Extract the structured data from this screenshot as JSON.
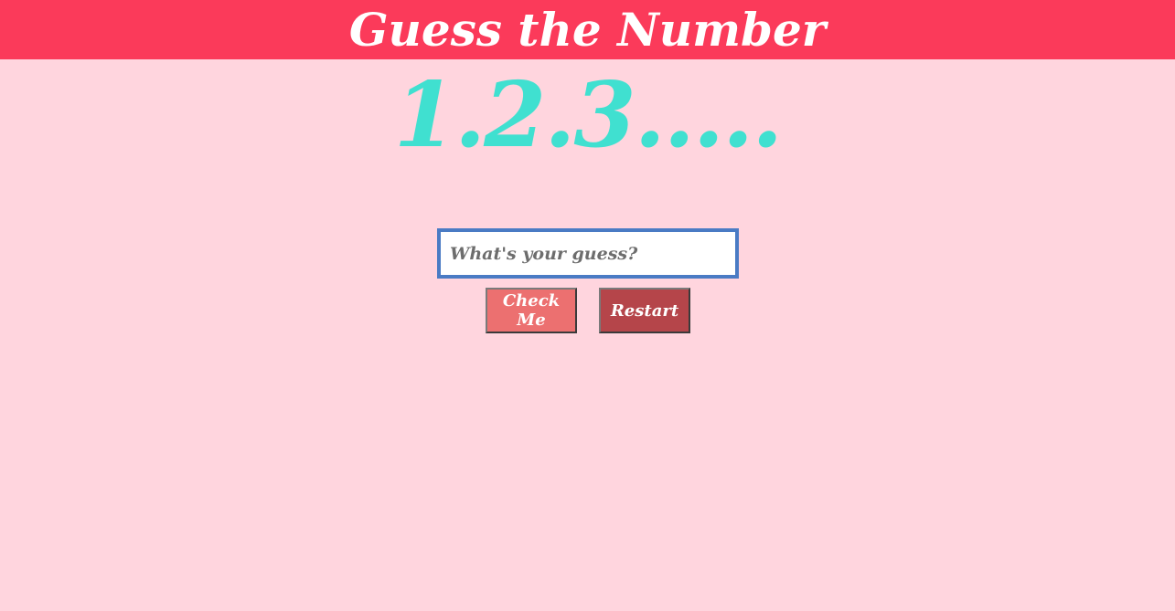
{
  "header": {
    "title": "Guess the Number"
  },
  "game": {
    "counter_text": "1.2.3.....",
    "guess_placeholder": "What's your guess?",
    "guess_value": "",
    "check_label": "Check Me",
    "restart_label": "Restart"
  },
  "colors": {
    "header_bg": "#fb3a5a",
    "page_bg": "#ffd5de",
    "counter": "#40e0d0",
    "input_border": "#4a7bc4",
    "check_bg": "#ec7070",
    "restart_bg": "#b5454a"
  }
}
